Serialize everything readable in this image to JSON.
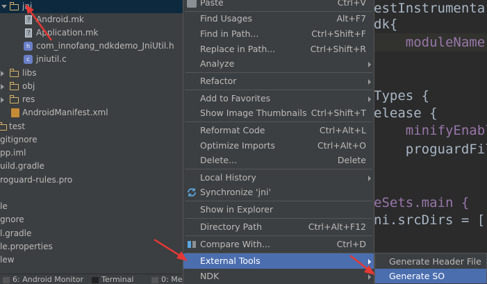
{
  "tree": {
    "items": [
      {
        "label": "jni",
        "icon": "folder-icon",
        "expanded": true,
        "selected": true
      },
      {
        "label": "Android.mk",
        "icon": "mk-file-icon"
      },
      {
        "label": "Application.mk",
        "icon": "mk-file-icon"
      },
      {
        "label": "com_innofang_ndkdemo_JniUtil.h",
        "icon": "header-file-icon"
      },
      {
        "label": "jniutil.c",
        "icon": "c-file-icon"
      },
      {
        "label": "libs",
        "icon": "folder-icon"
      },
      {
        "label": "obj",
        "icon": "folder-icon"
      },
      {
        "label": "res",
        "icon": "res-folder-icon"
      },
      {
        "label": "AndroidManifest.xml",
        "icon": "manifest-icon"
      },
      {
        "label": "test",
        "icon": "folder-icon"
      },
      {
        "label": "gitignore"
      },
      {
        "label": "pp.iml"
      },
      {
        "label": "uild.gradle"
      },
      {
        "label": "roguard-rules.pro"
      },
      {
        "label": ""
      },
      {
        "label": "le"
      },
      {
        "label": "gnore"
      },
      {
        "label": "l.gradle"
      },
      {
        "label": "le.properties"
      },
      {
        "label": "lew"
      }
    ]
  },
  "editor": {
    "lines": [
      "estInstrumenta",
      "dk{",
      "    moduleName",
      "",
      "",
      "Types {",
      "elease {",
      "    minifyEnabl",
      "    proguardFil",
      "",
      "",
      "eSets.main {",
      "ni.srcDirs = ["
    ]
  },
  "menu": {
    "items": [
      {
        "label": "Paste",
        "shortcut": "Ctrl+V"
      },
      {
        "label": "Find Usages",
        "shortcut": "Alt+F7"
      },
      {
        "label": "Find in Path...",
        "shortcut": "Ctrl+Shift+F"
      },
      {
        "label": "Replace in Path...",
        "shortcut": "Ctrl+Shift+R"
      },
      {
        "label": "Analyze",
        "shortcut": ""
      },
      {
        "label": "Refactor",
        "shortcut": ""
      },
      {
        "label": "Add to Favorites",
        "shortcut": ""
      },
      {
        "label": "Show Image Thumbnails",
        "shortcut": "Ctrl+Shift+T"
      },
      {
        "label": "Reformat Code",
        "shortcut": "Ctrl+Alt+L"
      },
      {
        "label": "Optimize Imports",
        "shortcut": "Ctrl+Alt+O"
      },
      {
        "label": "Delete...",
        "shortcut": "Delete"
      },
      {
        "label": "Local History",
        "shortcut": ""
      },
      {
        "label": "Synchronize 'jni'",
        "shortcut": ""
      },
      {
        "label": "Show in Explorer",
        "shortcut": ""
      },
      {
        "label": "Directory Path",
        "shortcut": "Ctrl+Alt+F12"
      },
      {
        "label": "Compare With...",
        "shortcut": "Ctrl+D"
      },
      {
        "label": "External Tools",
        "shortcut": ""
      },
      {
        "label": "NDK",
        "shortcut": ""
      }
    ]
  },
  "submenu": {
    "items": [
      {
        "label": "Generate Header File"
      },
      {
        "label": "Generate SO"
      }
    ]
  },
  "bottom_bar": {
    "items": [
      "6: Android Monitor",
      "Terminal",
      "0: Me"
    ]
  },
  "colors": {
    "selection": "#4b6eaf",
    "annotation": "#e53935",
    "keyword": "#cc7832",
    "accent_text": "#9876aa"
  }
}
